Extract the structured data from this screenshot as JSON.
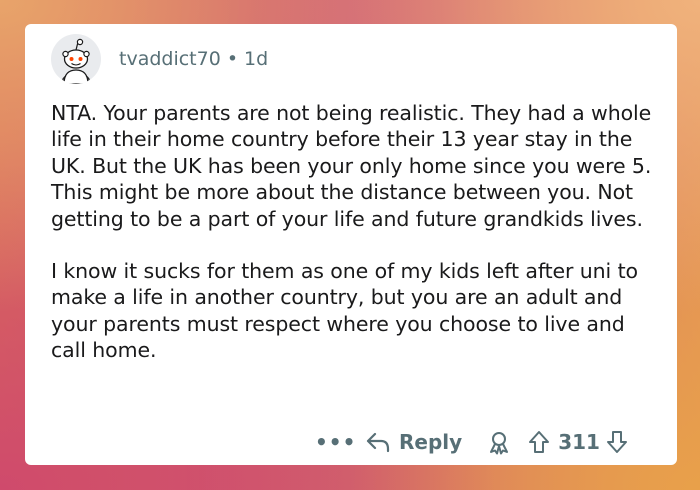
{
  "comment": {
    "username": "tvaddict70",
    "separator": "•",
    "time_ago": "1d",
    "paragraphs": [
      "NTA. Your parents are not being realistic. They had a whole life in their home country before their 13 year stay in the UK. But the UK has been your only home since you were 5. This might be more about the distance between you. Not getting to be a part of your life and future grandkids lives.",
      "I know it sucks for them as one of my kids left after uni to make a life in another country, but you are an adult and your parents must respect where you choose to live and call home."
    ]
  },
  "actions": {
    "more_label": "•••",
    "reply_label": "Reply",
    "vote_count": "311"
  },
  "colors": {
    "text": "#1a1a1b",
    "meta": "#576f76",
    "avatar_bg": "#e9ebee",
    "snoo_accent": "#ff4500"
  },
  "icons": {
    "avatar": "snoo-avatar-icon",
    "reply": "reply-arrow-icon",
    "award": "award-icon",
    "upvote": "upvote-arrow-icon",
    "downvote": "downvote-arrow-icon"
  }
}
